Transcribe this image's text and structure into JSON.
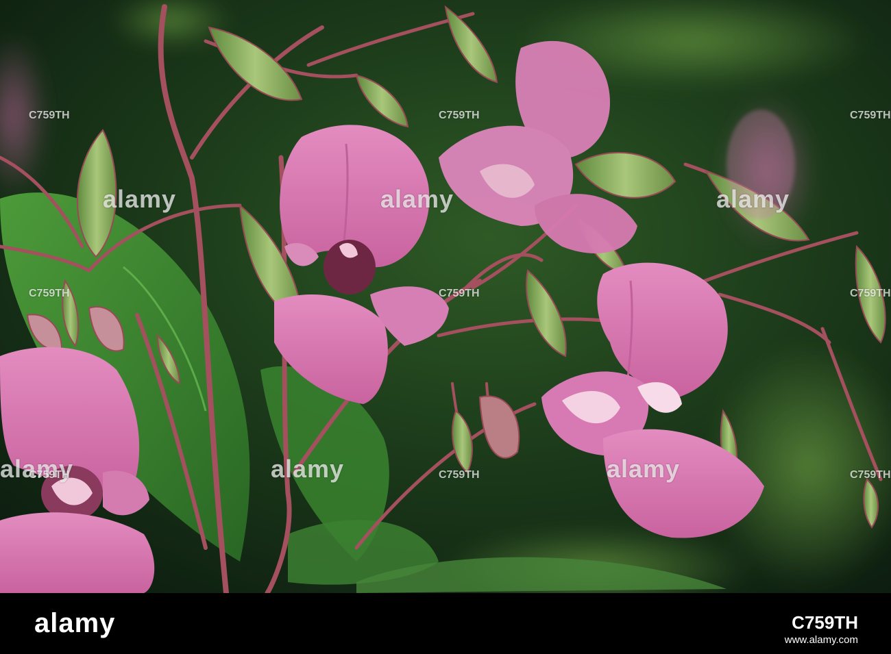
{
  "watermark": {
    "brand": "alamy",
    "stock_id": "C759TH"
  },
  "footer": {
    "logo": "alamy",
    "image_id": "C759TH",
    "url": "www.alamy.com"
  },
  "colors": {
    "petal": "#d877b0",
    "petal_dark": "#b35b93",
    "stem": "#a5505f",
    "bud": "#7ea654",
    "leaf": "#3f8a32",
    "background": "#16301a",
    "footer": "#000000"
  }
}
